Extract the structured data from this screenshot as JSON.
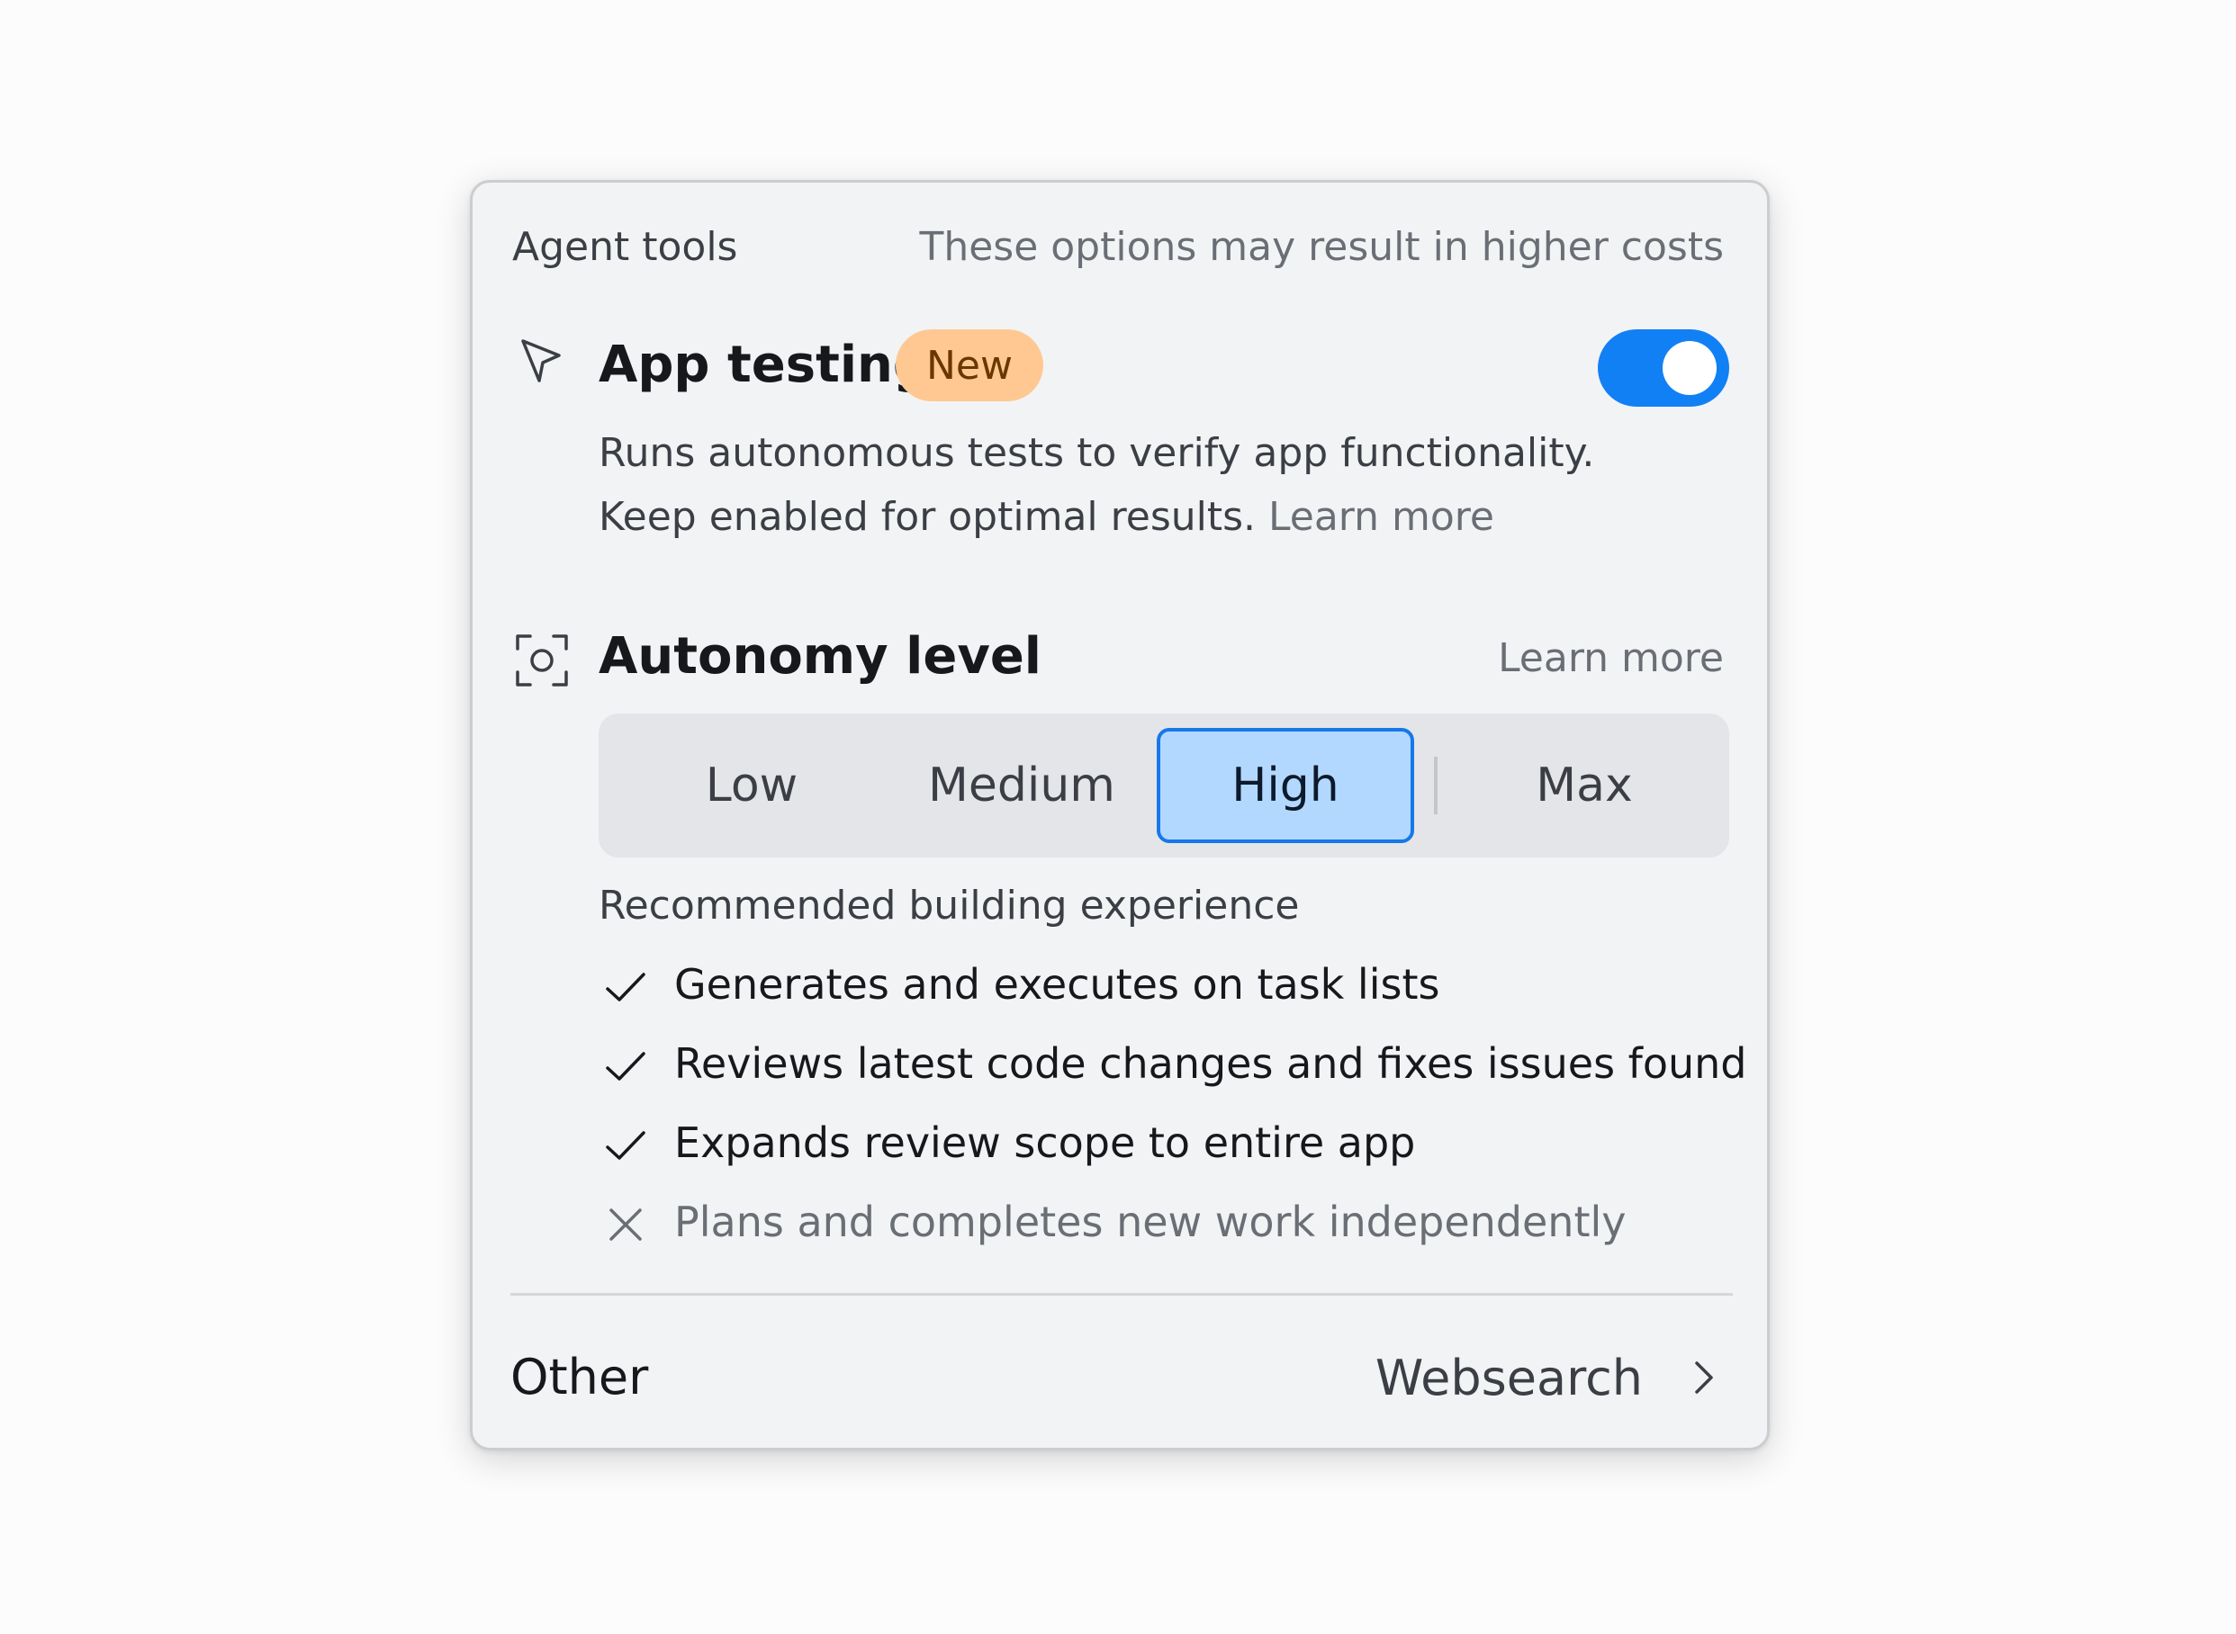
{
  "header": {
    "title": "Agent tools",
    "note": "These options may result in higher costs"
  },
  "app_testing": {
    "icon": "cursor-pointer-icon",
    "title": "App testing",
    "badge": "New",
    "enabled": true,
    "description_line1": "Runs autonomous tests to verify app functionality.",
    "description_line2": "Keep enabled for optimal results.",
    "learn_more": "Learn more",
    "toggle_color": "#1280f5",
    "badge_color": "#ffc893"
  },
  "autonomy": {
    "icon": "focus-scope-icon",
    "title": "Autonomy level",
    "learn_more": "Learn more",
    "options": [
      "Low",
      "Medium",
      "High",
      "Max"
    ],
    "selected": "High",
    "selected_color": "#b3d8ff",
    "recommended_title": "Recommended building experience",
    "features": [
      {
        "text": "Generates and executes on task lists",
        "included": true
      },
      {
        "text": "Reviews latest code changes and fixes issues found",
        "included": true
      },
      {
        "text": "Expands review scope to entire app",
        "included": true
      },
      {
        "text": "Plans and completes new work independently",
        "included": false
      }
    ]
  },
  "other": {
    "label": "Other",
    "value": "Websearch",
    "icon": "chevron-right-icon"
  }
}
